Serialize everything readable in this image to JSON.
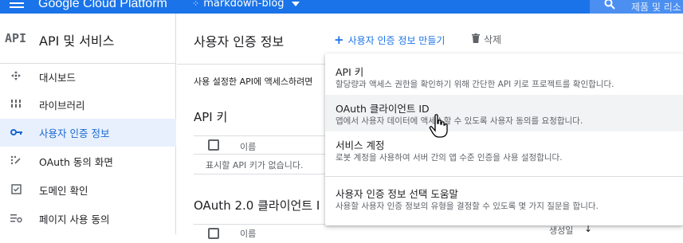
{
  "topbar": {
    "brand": "Google Cloud Platform",
    "project": "markdown-blog",
    "search_placeholder": "제품 및 리소"
  },
  "sidebar": {
    "logo": "API",
    "title": "API 및 서비스",
    "items": [
      {
        "label": "대시보드",
        "icon": "dashboard-icon",
        "active": false
      },
      {
        "label": "라이브러리",
        "icon": "library-icon",
        "active": false
      },
      {
        "label": "사용자 인증 정보",
        "icon": "key-icon",
        "active": true
      },
      {
        "label": "OAuth 동의 화면",
        "icon": "consent-icon",
        "active": false
      },
      {
        "label": "도메인 확인",
        "icon": "checkbox-icon",
        "active": false
      },
      {
        "label": "페이지 사용 동의",
        "icon": "settings-list-icon",
        "active": false
      }
    ]
  },
  "main": {
    "title": "사용자 인증 정보",
    "create_label": "사용자 인증 정보 만들기",
    "delete_label": "삭제",
    "description": "사용 설정한 API에 액세스하려면",
    "api_keys": {
      "heading": "API 키",
      "column_name": "이름",
      "empty_text": "표시할 API 키가 없습니다."
    },
    "oauth_clients": {
      "heading": "OAuth 2.0 클라이언트 I",
      "column_name": "이름",
      "column_created": "생성일"
    }
  },
  "menu": {
    "items": [
      {
        "title": "API 키",
        "subtitle": "할당량과 액세스 권한을 확인하기 위해 간단한 API 키로 프로젝트를 확인합니다."
      },
      {
        "title": "OAuth 클라이언트 ID",
        "subtitle": "앱에서 사용자 데이터에 액세스할 수 있도록 사용자 동의를 요청합니다."
      },
      {
        "title": "서비스 계정",
        "subtitle": "로봇 계정을 사용하여 서버 간의 앱 수준 인증을 사용 설정합니다."
      },
      {
        "title": "사용자 인증 정보 선택 도움말",
        "subtitle": "사용할 사용자 인증 정보의 유형을 결정할 수 있도록 몇 가지 질문을 합니다."
      }
    ]
  },
  "colors": {
    "topbar": "#1a73e8",
    "accent": "#1967d2",
    "active_bg": "#e8f0fe",
    "hover_bg": "#f1f3f4"
  }
}
